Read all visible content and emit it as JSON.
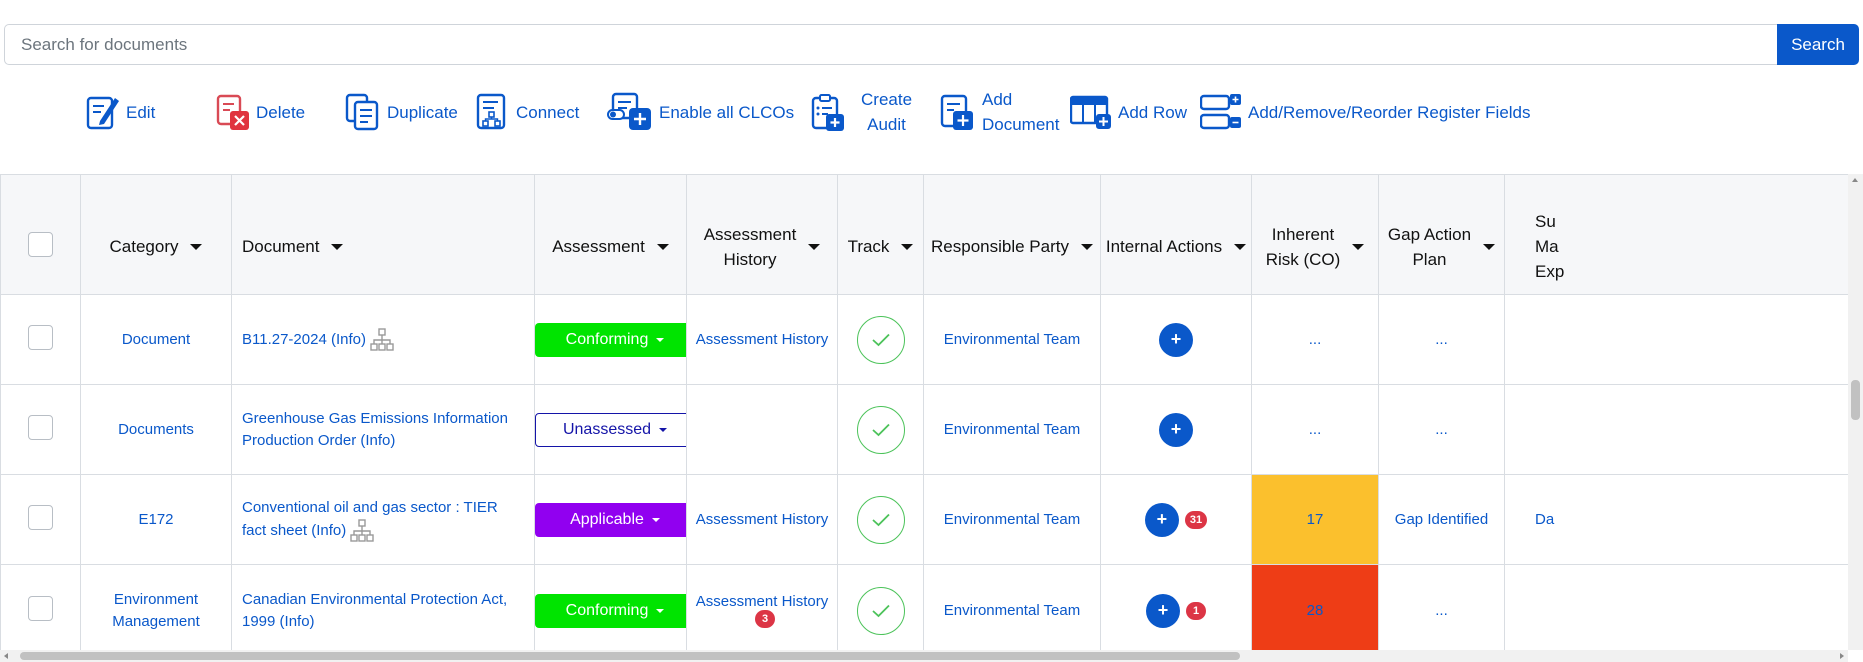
{
  "search": {
    "placeholder": "Search for documents",
    "button_label": "Search"
  },
  "toolbar": {
    "edit": "Edit",
    "delete": "Delete",
    "duplicate": "Duplicate",
    "connect": "Connect",
    "enable_all": "Enable all CLCOs",
    "create_audit": "Create\nAudit",
    "add_document": "Add\nDocument",
    "add_row": "Add Row",
    "register_fields": "Add/Remove/Reorder Register Fields"
  },
  "table": {
    "headers": {
      "category": "Category",
      "document": "Document",
      "assessment": "Assessment",
      "assessment_history": "Assessment\nHistory",
      "track": "Track",
      "responsible_party": "Responsible Party",
      "internal_actions": "Internal Actions",
      "inherent_risk": "Inherent\nRisk (CO)",
      "gap_action_plan": "Gap Action\nPlan",
      "next_partial": "Su\nMa\nExp"
    },
    "rows": [
      {
        "category": "Document",
        "document": "B11.27-2024 (Info)",
        "assessment": "Conforming",
        "assessment_history": "Assessment History",
        "history_badge": "",
        "responsible_party": "Environmental Team",
        "actions_badge": "",
        "risk": "...",
        "gap": "...",
        "next": ""
      },
      {
        "category": "Documents",
        "document": "Greenhouse Gas Emissions Information Production Order (Info)",
        "assessment": "Unassessed",
        "assessment_history": "",
        "history_badge": "",
        "responsible_party": "Environmental Team",
        "actions_badge": "",
        "risk": "...",
        "gap": "...",
        "next": ""
      },
      {
        "category": "E172",
        "document": "Conventional oil and gas sector : TIER fact sheet (Info)",
        "assessment": "Applicable",
        "assessment_history": "Assessment History",
        "history_badge": "",
        "responsible_party": "Environmental Team",
        "actions_badge": "31",
        "risk": "17",
        "gap": "Gap Identified",
        "next": "Da"
      },
      {
        "category": "Environment Management",
        "document": "Canadian Environmental Protection Act, 1999 (Info)",
        "assessment": "Conforming",
        "assessment_history": "Assessment History",
        "history_badge": "3",
        "responsible_party": "Environmental Team",
        "actions_badge": "1",
        "risk": "28",
        "gap": "...",
        "next": ""
      }
    ],
    "plus_label": "+"
  },
  "colors": {
    "accent": "#0a58ca",
    "conforming": "#00e400",
    "applicable": "#9100f0",
    "unassessed": "#1414a8",
    "risk_medium": "#fbc02d",
    "risk_high": "#ee3d16"
  }
}
